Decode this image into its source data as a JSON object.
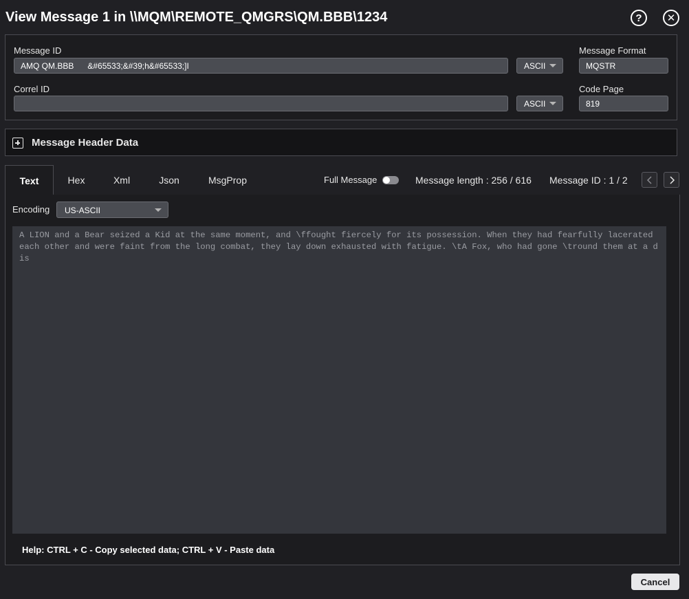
{
  "window": {
    "title": "View Message 1 in \\\\MQM\\REMOTE_QMGRS\\QM.BBB\\1234",
    "help_glyph": "?",
    "close_glyph": "✕"
  },
  "fields": {
    "message_id": {
      "label": "Message ID",
      "value": "AMQ QM.BBB      &#65533;&#39;h&#65533;]I",
      "encoding": "ASCII"
    },
    "correl_id": {
      "label": "Correl ID",
      "value": "",
      "encoding": "ASCII"
    },
    "message_format": {
      "label": "Message Format",
      "value": "MQSTR"
    },
    "code_page": {
      "label": "Code Page",
      "value": "819"
    }
  },
  "header_section": {
    "label": "Message Header Data",
    "icon": "plus-square-icon"
  },
  "tabs": [
    {
      "label": "Text",
      "active": true
    },
    {
      "label": "Hex",
      "active": false
    },
    {
      "label": "Xml",
      "active": false
    },
    {
      "label": "Json",
      "active": false
    },
    {
      "label": "MsgProp",
      "active": false
    }
  ],
  "toolbar": {
    "full_message_label": "Full Message",
    "full_message_on": false,
    "message_length": "Message length : 256 / 616",
    "message_index": "Message ID : 1 / 2"
  },
  "body": {
    "encoding_label": "Encoding",
    "encoding_value": "US-ASCII",
    "content": "A LION and a Bear seized a Kid at the same moment, and \\ffought fiercely for its possession. When they had fearfully lacerated each other and were faint from the long combat, they lay down exhausted with fatigue. \\tA Fox, who had gone \\tround them at a dis",
    "help": "Help: CTRL + C - Copy selected data; CTRL + V - Paste data"
  },
  "footer": {
    "cancel_label": "Cancel"
  },
  "colors": {
    "background": "#202024",
    "panel": "#1c1c1f",
    "input": "#4a4c52",
    "text_area": "#34363c",
    "text_area_font": "#9a9ca2"
  }
}
